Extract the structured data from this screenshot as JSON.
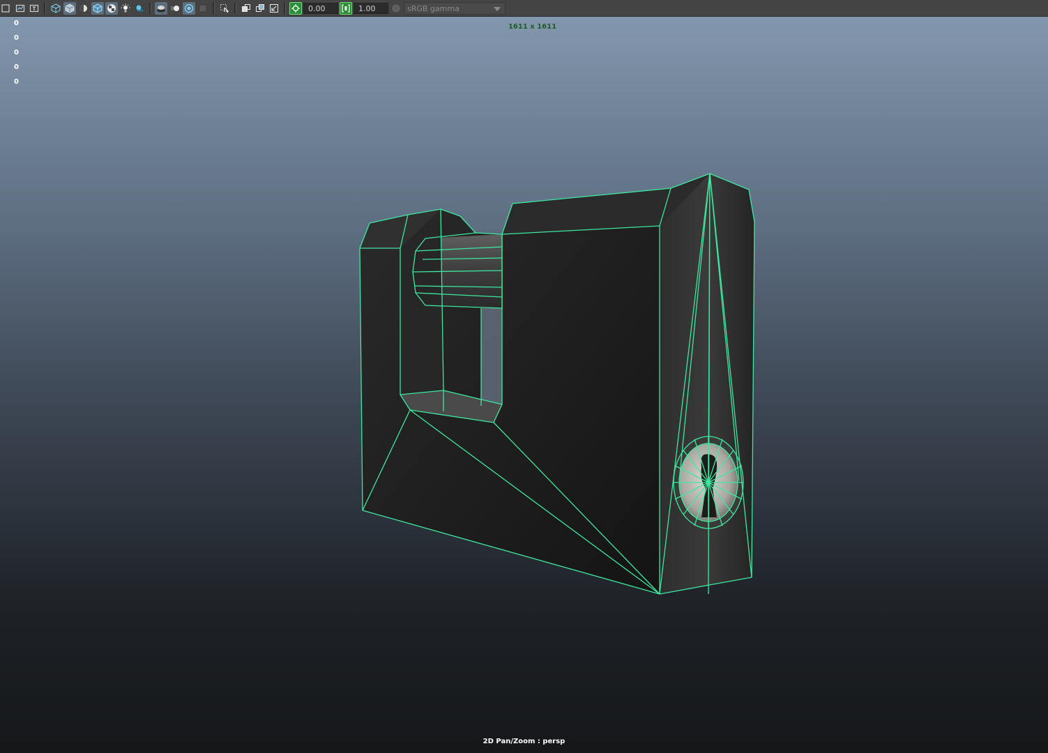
{
  "toolbar": {
    "exposure_value": "0.00",
    "gamma_value": "1.00",
    "color_space": "sRGB gamma"
  },
  "viewport": {
    "hud_counts": [
      "0",
      "0",
      "0",
      "0",
      "0"
    ],
    "resolution_label": "1611 x 1611",
    "camera_label": "2D Pan/Zoom : persp",
    "background_top": "#8296ad",
    "background_bottom": "#151719",
    "wireframe_color": "#3ee8a0"
  },
  "model": {
    "name": "padlock"
  }
}
